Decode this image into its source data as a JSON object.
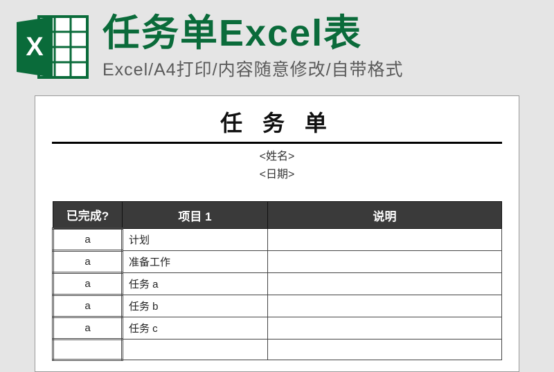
{
  "header": {
    "title": "任务单Excel表",
    "subtitle": "Excel/A4打印/内容随意修改/自带格式",
    "icon_label": "X"
  },
  "sheet": {
    "title": "任 务 单",
    "name_placeholder": "<姓名>",
    "date_placeholder": "<日期>",
    "columns": {
      "done": "已完成?",
      "project": "项目 1",
      "description": "说明"
    },
    "rows": [
      {
        "done": "a",
        "project": "计划",
        "description": ""
      },
      {
        "done": "a",
        "project": "准备工作",
        "description": ""
      },
      {
        "done": "a",
        "project": "任务 a",
        "description": ""
      },
      {
        "done": "a",
        "project": "任务 b",
        "description": ""
      },
      {
        "done": "a",
        "project": "任务 c",
        "description": ""
      },
      {
        "done": "",
        "project": "",
        "description": ""
      }
    ]
  }
}
